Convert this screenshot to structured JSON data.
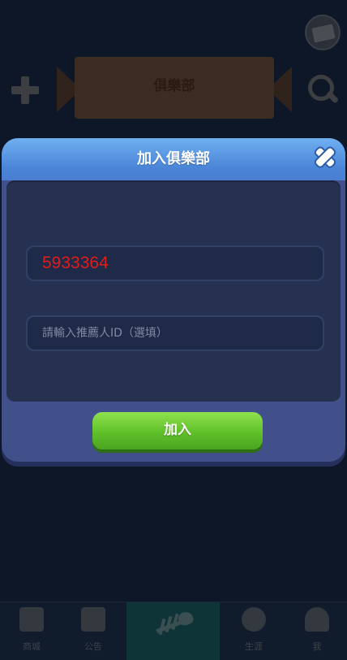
{
  "background": {
    "banner_title": "俱樂部"
  },
  "modal": {
    "title": "加入俱樂部",
    "club_id_value": "5933364",
    "referrer_placeholder": "請輸入推薦人ID（選填）",
    "join_button_label": "加入"
  },
  "nav": {
    "items": [
      {
        "label": "商城",
        "icon": "store-icon"
      },
      {
        "label": "公告",
        "icon": "calendar-icon"
      },
      {
        "label": "",
        "icon": "fish-bone-icon"
      },
      {
        "label": "生涯",
        "icon": "pie-chart-icon"
      },
      {
        "label": "我",
        "icon": "person-icon"
      }
    ]
  },
  "colors": {
    "modal_header": "#5a95e0",
    "modal_body": "#414f8b",
    "club_id_text": "#e21b1b",
    "join_button": "#5fc02a"
  }
}
